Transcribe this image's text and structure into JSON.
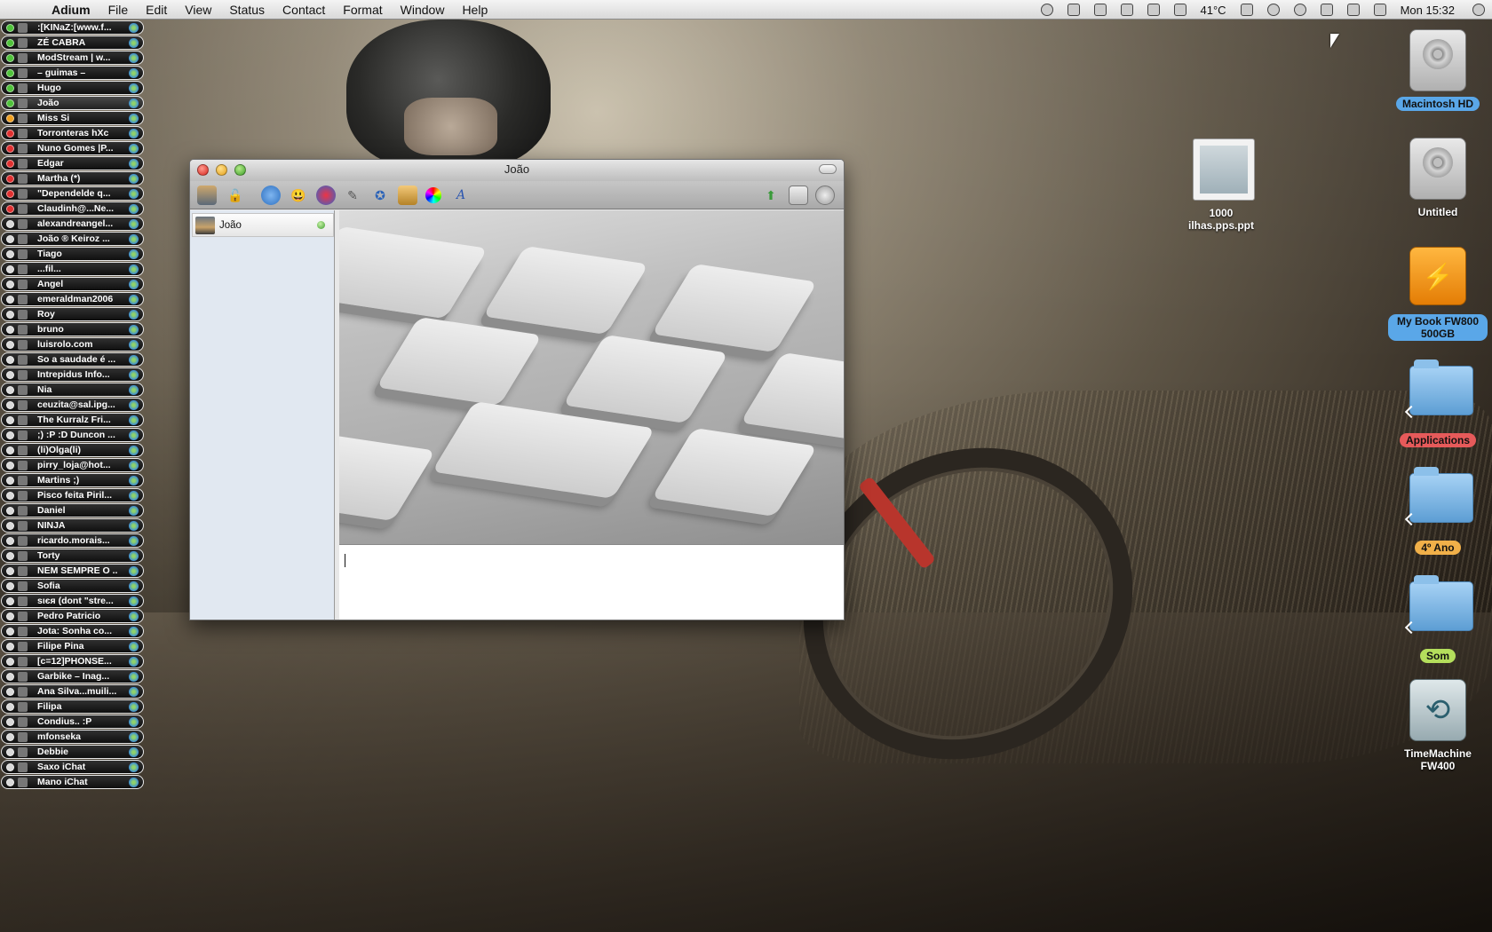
{
  "menubar": {
    "app_name": "Adium",
    "items": [
      "File",
      "Edit",
      "View",
      "Status",
      "Contact",
      "Format",
      "Window",
      "Help"
    ],
    "temperature": "41°C",
    "clock": "Mon 15:32"
  },
  "buddies": [
    {
      "name": ":[KINaZ:[www.f...",
      "status": "#4fc23a"
    },
    {
      "name": "ZÉ CABRA",
      "status": "#4fc23a"
    },
    {
      "name": "ModStream | w...",
      "status": "#4fc23a"
    },
    {
      "name": "– guimas –",
      "status": "#4fc23a"
    },
    {
      "name": "Hugo",
      "status": "#4fc23a"
    },
    {
      "name": "João",
      "status": "#4fc23a"
    },
    {
      "name": "Miss Si",
      "status": "#f0a020"
    },
    {
      "name": "Torronteras hXc",
      "status": "#e03030"
    },
    {
      "name": "Nuno Gomes |P...",
      "status": "#e03030"
    },
    {
      "name": "Edgar",
      "status": "#e03030"
    },
    {
      "name": "Martha (*)",
      "status": "#e03030"
    },
    {
      "name": "\"Dependelde q...",
      "status": "#e03030"
    },
    {
      "name": "Claudinh@...Ne...",
      "status": "#e03030"
    },
    {
      "name": "alexandreangel...",
      "status": "#d9d9d9"
    },
    {
      "name": "João ® Keiroz ...",
      "status": "#d9d9d9"
    },
    {
      "name": "Tiago",
      "status": "#d9d9d9"
    },
    {
      "name": "...fil...",
      "status": "#d9d9d9"
    },
    {
      "name": "Angel",
      "status": "#d9d9d9"
    },
    {
      "name": "emeraldman2006",
      "status": "#d9d9d9"
    },
    {
      "name": "Roy",
      "status": "#d9d9d9"
    },
    {
      "name": "bruno",
      "status": "#d9d9d9"
    },
    {
      "name": "luisrolo.com",
      "status": "#d9d9d9"
    },
    {
      "name": "So a saudade é ...",
      "status": "#d9d9d9"
    },
    {
      "name": "Intrepidus Info...",
      "status": "#d9d9d9"
    },
    {
      "name": "Nia",
      "status": "#d9d9d9"
    },
    {
      "name": "ceuzita@sal.ipg...",
      "status": "#d9d9d9"
    },
    {
      "name": "The Kurralz Fri...",
      "status": "#d9d9d9"
    },
    {
      "name": ";) :P :D Duncon ...",
      "status": "#d9d9d9"
    },
    {
      "name": "(li)Olga(li)",
      "status": "#d9d9d9"
    },
    {
      "name": "pirry_loja@hot...",
      "status": "#d9d9d9"
    },
    {
      "name": "Martins ;)",
      "status": "#d9d9d9"
    },
    {
      "name": "Pisco feita Piril...",
      "status": "#d9d9d9"
    },
    {
      "name": "Daniel",
      "status": "#d9d9d9"
    },
    {
      "name": "NINJA",
      "status": "#d9d9d9"
    },
    {
      "name": "ricardo.morais...",
      "status": "#d9d9d9"
    },
    {
      "name": "Torty",
      "status": "#d9d9d9"
    },
    {
      "name": "NEM SEMPRE O ...",
      "status": "#d9d9d9"
    },
    {
      "name": "Sofia",
      "status": "#d9d9d9"
    },
    {
      "name": "sιєя (dont \"stre...",
      "status": "#d9d9d9"
    },
    {
      "name": "Pedro Patricio",
      "status": "#d9d9d9"
    },
    {
      "name": "Jota: Sonha co...",
      "status": "#d9d9d9"
    },
    {
      "name": "Filipe Pina",
      "status": "#d9d9d9"
    },
    {
      "name": "[c=12]PHONSE...",
      "status": "#d9d9d9"
    },
    {
      "name": "Garbike – Inag...",
      "status": "#d9d9d9"
    },
    {
      "name": "Ana Silva...muili...",
      "status": "#d9d9d9"
    },
    {
      "name": "Filipa",
      "status": "#d9d9d9"
    },
    {
      "name": "Condius.. :P",
      "status": "#d9d9d9"
    },
    {
      "name": "mfonseka",
      "status": "#d9d9d9"
    },
    {
      "name": "Debbie",
      "status": "#d9d9d9"
    },
    {
      "name": "Saxo iChat",
      "status": "#d9d9d9"
    },
    {
      "name": "Mano iChat",
      "status": "#d9d9d9"
    }
  ],
  "chat": {
    "title": "João",
    "tab_name": "João",
    "input_value": ""
  },
  "desktop": {
    "icons": [
      {
        "label": "Macintosh HD"
      },
      {
        "label": "Untitled"
      },
      {
        "label": "1000 ilhas.pps.ppt"
      },
      {
        "label": "My Book FW800 500GB"
      },
      {
        "label": "Applications"
      },
      {
        "label": "4º Ano"
      },
      {
        "label": "Som"
      },
      {
        "label": "TimeMachine FW400"
      }
    ]
  }
}
